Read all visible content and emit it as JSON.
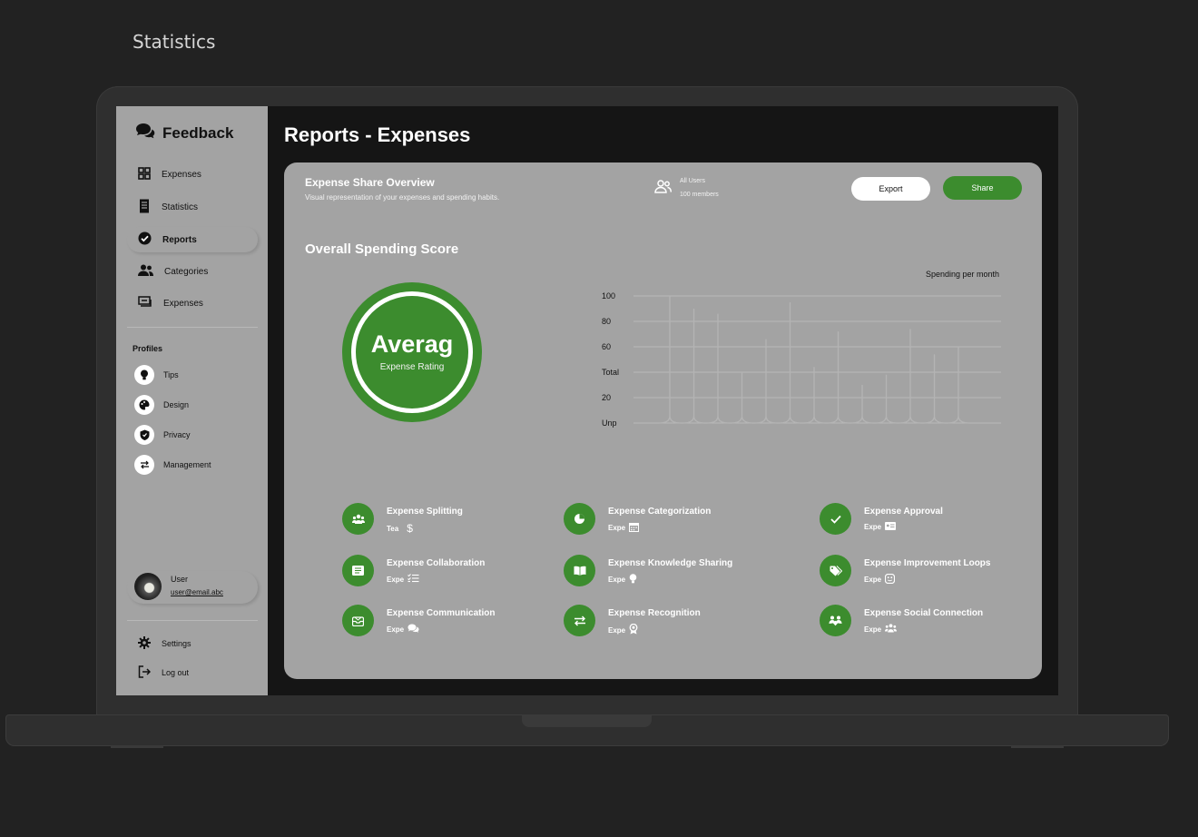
{
  "page": {
    "title": "Statistics"
  },
  "sidebar": {
    "brand": "Feedback",
    "nav": [
      {
        "label": "Expenses",
        "icon": "grid-icon"
      },
      {
        "label": "Statistics",
        "icon": "receipt-icon"
      },
      {
        "label": "Reports",
        "icon": "check-circle-icon",
        "active": true
      },
      {
        "label": "Categories",
        "icon": "users-icon"
      },
      {
        "label": "Expenses",
        "icon": "money-transfer-icon"
      }
    ],
    "profiles_label": "Profiles",
    "profiles": [
      {
        "label": "Tips",
        "icon": "lightbulb-icon"
      },
      {
        "label": "Design",
        "icon": "palette-icon"
      },
      {
        "label": "Privacy",
        "icon": "shield-icon"
      },
      {
        "label": "Management",
        "icon": "arrows-icon"
      }
    ],
    "user": {
      "name": "User",
      "email": "user@email.abc"
    },
    "settings_label": "Settings",
    "logout_label": "Log out"
  },
  "main": {
    "title": "Reports - Expenses",
    "card": {
      "title": "Expense Share Overview",
      "subtitle": "Visual representation of your expenses and spending habits.",
      "users_label": "All Users",
      "users_count": "100 members",
      "export_label": "Export",
      "share_label": "Share"
    },
    "score": {
      "title": "Overall Spending Score",
      "rating_value": "Averag",
      "rating_label": "Expense Rating"
    },
    "features": [
      {
        "title": "Expense Splitting",
        "sub": "Tea",
        "icon": "users-icon",
        "sub_icon": "dollar-icon"
      },
      {
        "title": "Expense Categorization",
        "sub": "Expe",
        "icon": "pie-chart-icon",
        "sub_icon": "calendar-icon"
      },
      {
        "title": "Expense Approval",
        "sub": "Expe",
        "icon": "check-icon",
        "sub_icon": "id-card-icon"
      },
      {
        "title": "Expense Collaboration",
        "sub": "Expe",
        "icon": "list-icon",
        "sub_icon": "checklist-icon"
      },
      {
        "title": "Expense Knowledge Sharing",
        "sub": "Expe",
        "icon": "book-icon",
        "sub_icon": "lightbulb-icon"
      },
      {
        "title": "Expense Improvement Loops",
        "sub": "Expe",
        "icon": "tags-icon",
        "sub_icon": "face-icon"
      },
      {
        "title": "Expense Communication",
        "sub": "Expe",
        "icon": "inbox-icon",
        "sub_icon": "chat-icon"
      },
      {
        "title": "Expense Recognition",
        "sub": "Expe",
        "icon": "swap-icon",
        "sub_icon": "award-icon"
      },
      {
        "title": "Expense Social Connection",
        "sub": "Expe",
        "icon": "handshake-icon",
        "sub_icon": "group-icon"
      }
    ]
  },
  "colors": {
    "accent": "#3c8c2e",
    "panel": "#a3a3a3",
    "background": "#222222"
  },
  "chart_data": {
    "type": "bar",
    "title": "Spending per month",
    "y_tick_labels": [
      "100",
      "80",
      "60",
      "Total",
      "20",
      "Unp"
    ],
    "ylim": [
      0,
      100
    ],
    "grid": true,
    "values": [
      100,
      90,
      86,
      40,
      66,
      95,
      44,
      72,
      30,
      38,
      74,
      54,
      60
    ]
  }
}
